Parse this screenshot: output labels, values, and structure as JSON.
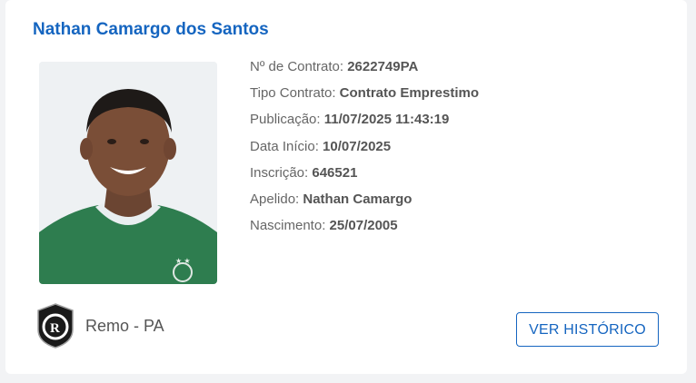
{
  "player": {
    "name": "Nathan Camargo dos Santos"
  },
  "fields": [
    {
      "label": "Nº de Contrato: ",
      "value": "2622749PA"
    },
    {
      "label": "Tipo Contrato: ",
      "value": "Contrato Emprestimo"
    },
    {
      "label": "Publicação: ",
      "value": "11/07/2025 11:43:19"
    },
    {
      "label": "Data Início: ",
      "value": "10/07/2025"
    },
    {
      "label": "Inscrição: ",
      "value": "646521"
    },
    {
      "label": "Apelido: ",
      "value": "Nathan Camargo"
    },
    {
      "label": "Nascimento: ",
      "value": "25/07/2005"
    }
  ],
  "club": {
    "name": "Remo - PA",
    "logo_icon": "remo-crest-icon"
  },
  "actions": {
    "history_label": "VER HISTÓRICO"
  },
  "colors": {
    "accent": "#1565c0",
    "jersey": "#2e7d4f",
    "card_bg": "#ffffff",
    "page_bg": "#f2f3f5"
  }
}
